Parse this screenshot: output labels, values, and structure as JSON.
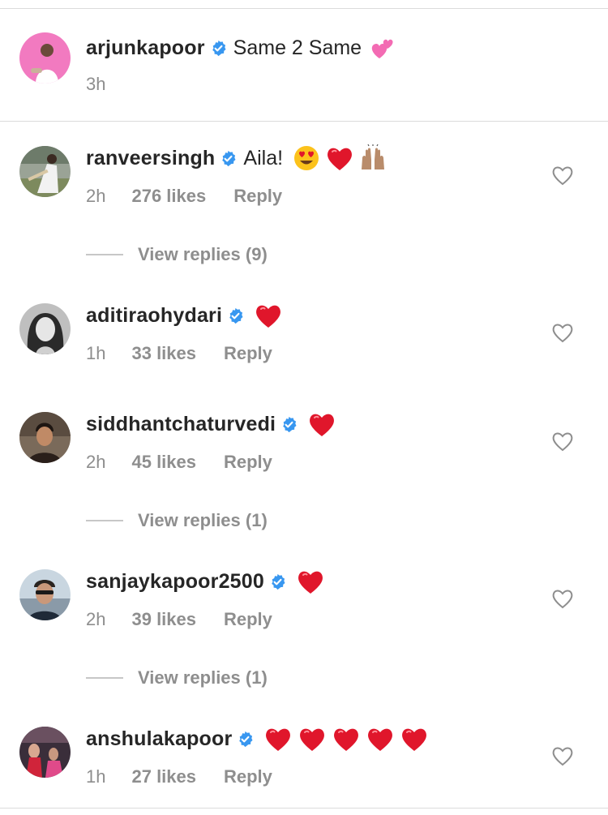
{
  "caption": {
    "username": "arjunkapoor",
    "text": "Same 2 Same",
    "emoji": "two-hearts-emoji",
    "time": "3h"
  },
  "comments": [
    {
      "username": "ranveersingh",
      "text": "Aila!",
      "emojis": [
        "heart-eyes-emoji",
        "red-heart-emoji",
        "raising-hands-emoji"
      ],
      "time": "2h",
      "likes": "276 likes",
      "reply": "Reply",
      "view_replies": "View replies (9)"
    },
    {
      "username": "aditiraohydari",
      "emojis": [
        "red-heart-emoji"
      ],
      "time": "1h",
      "likes": "33 likes",
      "reply": "Reply"
    },
    {
      "username": "siddhantchaturvedi",
      "emojis": [
        "red-heart-emoji"
      ],
      "time": "2h",
      "likes": "45 likes",
      "reply": "Reply",
      "view_replies": "View replies (1)"
    },
    {
      "username": "sanjaykapoor2500",
      "emojis": [
        "red-heart-emoji"
      ],
      "time": "2h",
      "likes": "39 likes",
      "reply": "Reply",
      "view_replies": "View replies (1)"
    },
    {
      "username": "anshulakapoor",
      "emojis": [
        "red-heart-emoji",
        "red-heart-emoji",
        "red-heart-emoji",
        "red-heart-emoji",
        "red-heart-emoji"
      ],
      "time": "1h",
      "likes": "27 likes",
      "reply": "Reply"
    }
  ],
  "colors": {
    "verified": "#3897f0",
    "heart": "#e0162b",
    "muted": "#8e8e8e",
    "text": "#262626"
  }
}
